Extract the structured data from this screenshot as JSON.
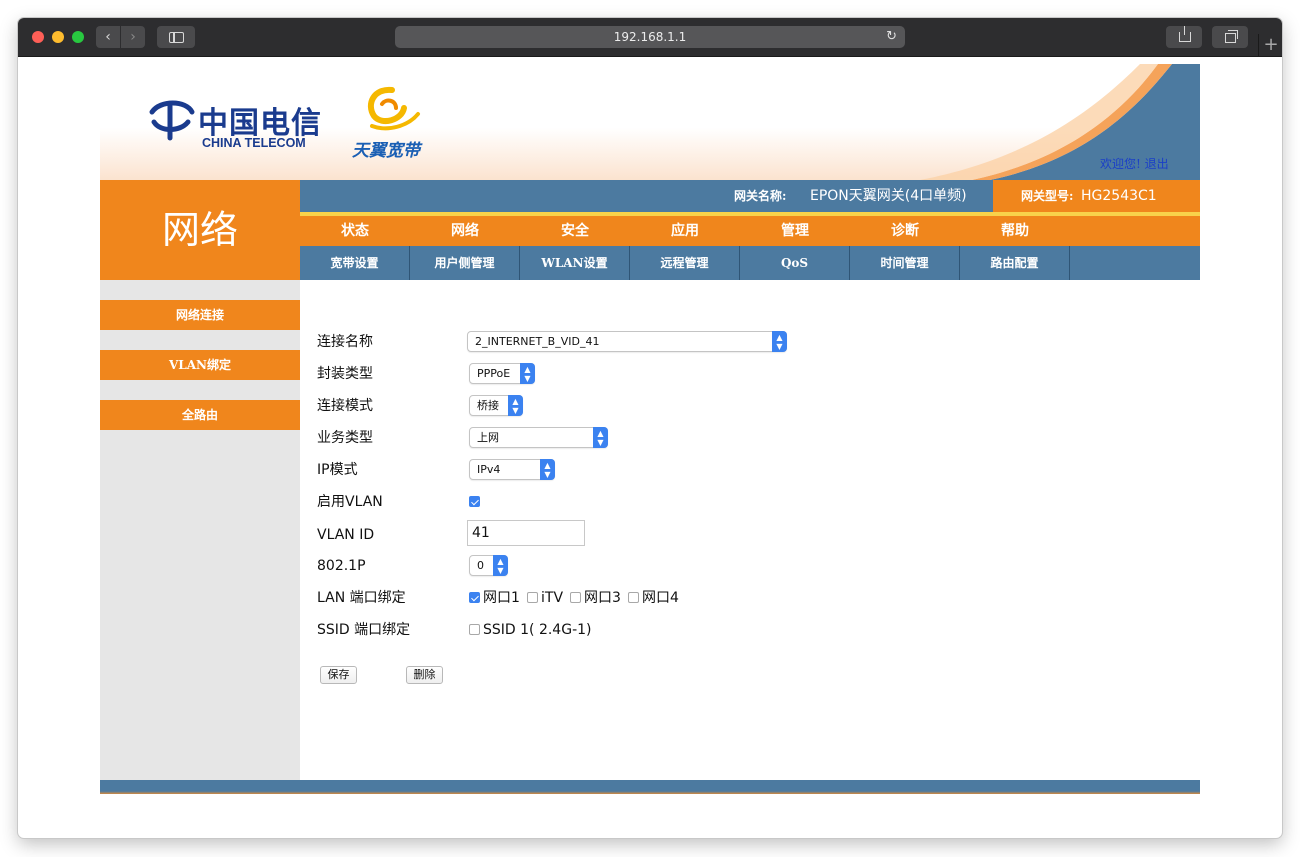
{
  "browser": {
    "url": "192.168.1.1",
    "back_glyph": "‹",
    "forward_glyph": "›",
    "new_tab_glyph": "+",
    "reload_glyph": "↻"
  },
  "header": {
    "ct_logo_cn": "中国电信",
    "ct_logo_en": "CHINA TELECOM",
    "tianyi_text": "天翼宽带",
    "welcome": "欢迎您!",
    "logout": "退出"
  },
  "section_title": "网络",
  "info_bar": {
    "gateway_name_label": "网关名称:",
    "gateway_name": "EPON天翼网关(4口单频)",
    "gateway_model_label": "网关型号:",
    "gateway_model": "HG2543C1"
  },
  "main_nav": [
    "状态",
    "网络",
    "安全",
    "应用",
    "管理",
    "诊断",
    "帮助"
  ],
  "sub_nav": [
    "宽带设置",
    "用户侧管理",
    "WLAN设置",
    "远程管理",
    "QoS",
    "时间管理",
    "路由配置"
  ],
  "left_menu": [
    "网络连接",
    "VLAN绑定",
    "全路由"
  ],
  "form": {
    "connection_name": {
      "label": "连接名称",
      "value": "2_INTERNET_B_VID_41"
    },
    "encap_type": {
      "label": "封装类型",
      "value": "PPPoE"
    },
    "conn_mode": {
      "label": "连接模式",
      "value": "桥接"
    },
    "service_type": {
      "label": "业务类型",
      "value": "上网"
    },
    "ip_mode": {
      "label": "IP模式",
      "value": "IPv4"
    },
    "enable_vlan": {
      "label": "启用VLAN",
      "checked": true
    },
    "vlan_id": {
      "label": "VLAN ID",
      "value": "41"
    },
    "dot1p": {
      "label": "802.1P",
      "value": "0"
    },
    "lan_bind": {
      "label": "LAN 端口绑定",
      "options": [
        {
          "text": "网口1",
          "checked": true
        },
        {
          "text": "iTV",
          "checked": false
        },
        {
          "text": "网口3",
          "checked": false
        },
        {
          "text": "网口4",
          "checked": false
        }
      ]
    },
    "ssid_bind": {
      "label": "SSID 端口绑定",
      "options": [
        {
          "text": "SSID 1( 2.4G-1)",
          "checked": false
        }
      ]
    },
    "save_label": "保存",
    "delete_label": "删除"
  },
  "colors": {
    "orange": "#f0861c",
    "steel_blue": "#4c7aa0",
    "accent_yellow": "#f9d24a",
    "link_blue": "#1a3fc8"
  }
}
